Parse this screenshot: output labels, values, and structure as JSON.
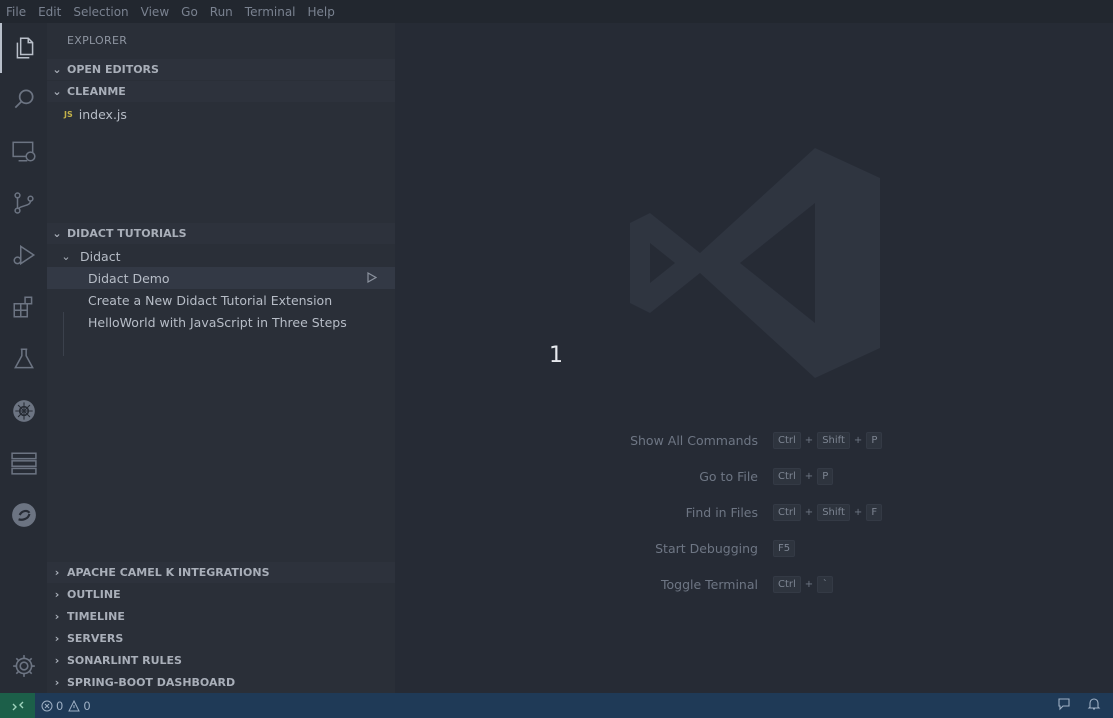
{
  "menu": [
    "File",
    "Edit",
    "Selection",
    "View",
    "Go",
    "Run",
    "Terminal",
    "Help"
  ],
  "activity_bar": [
    "files-icon",
    "search-icon",
    "remote-explorer-icon",
    "source-control-icon",
    "run-debug-icon",
    "extensions-icon",
    "testing-icon",
    "kubernetes-icon",
    "servers-icon",
    "sonarlint-icon",
    "settings-gear-icon"
  ],
  "sidebar": {
    "title": "EXPLORER",
    "open_editors": "OPEN EDITORS",
    "workspace": "CLEANME",
    "file_badge": "JS",
    "file": "index.js",
    "didact_header": "DIDACT TUTORIALS",
    "didact_group": "Didact",
    "didact_items": [
      "Didact Demo",
      "Create a New Didact Tutorial Extension",
      "HelloWorld with JavaScript in Three Steps"
    ],
    "collapsed_sections": [
      "APACHE CAMEL K INTEGRATIONS",
      "OUTLINE",
      "TIMELINE",
      "SERVERS",
      "SONARLINT RULES",
      "SPRING-BOOT DASHBOARD"
    ]
  },
  "editor": {
    "overlay_number": "1",
    "shortcuts": [
      {
        "label": "Show All Commands",
        "keys": [
          "Ctrl",
          "Shift",
          "P"
        ]
      },
      {
        "label": "Go to File",
        "keys": [
          "Ctrl",
          "P"
        ]
      },
      {
        "label": "Find in Files",
        "keys": [
          "Ctrl",
          "Shift",
          "F"
        ]
      },
      {
        "label": "Start Debugging",
        "keys": [
          "F5"
        ]
      },
      {
        "label": "Toggle Terminal",
        "keys": [
          "Ctrl",
          "`"
        ]
      }
    ]
  },
  "status": {
    "errors": "0",
    "warnings": "0"
  }
}
